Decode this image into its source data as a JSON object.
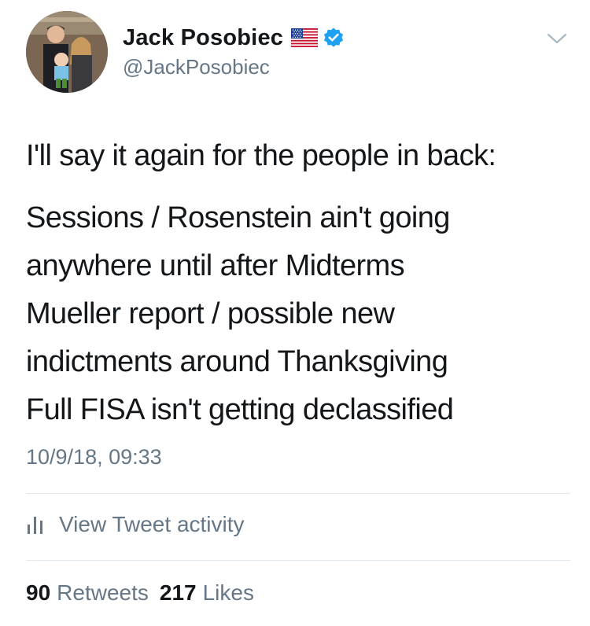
{
  "author": {
    "display_name": "Jack Posobiec",
    "handle": "@JackPosobiec",
    "flag_icon": "us-flag-icon",
    "verified_icon": "verified-badge-icon",
    "verified_color": "#1da1f2"
  },
  "tweet": {
    "lines": [
      "I'll say it again for the people in back:",
      "Sessions / Rosenstein ain't going",
      "anywhere until after Midterms",
      "Mueller report / possible new",
      "indictments around Thanksgiving",
      "Full FISA isn't getting declassified"
    ],
    "timestamp": "10/9/18, 09:33"
  },
  "activity": {
    "icon": "bar-chart-icon",
    "label": "View Tweet activity"
  },
  "stats": {
    "retweets_count": "90",
    "retweets_label": "Retweets",
    "likes_count": "217",
    "likes_label": "Likes"
  },
  "colors": {
    "text_primary": "#14171a",
    "text_secondary": "#657786",
    "divider": "#e1e8ed"
  }
}
